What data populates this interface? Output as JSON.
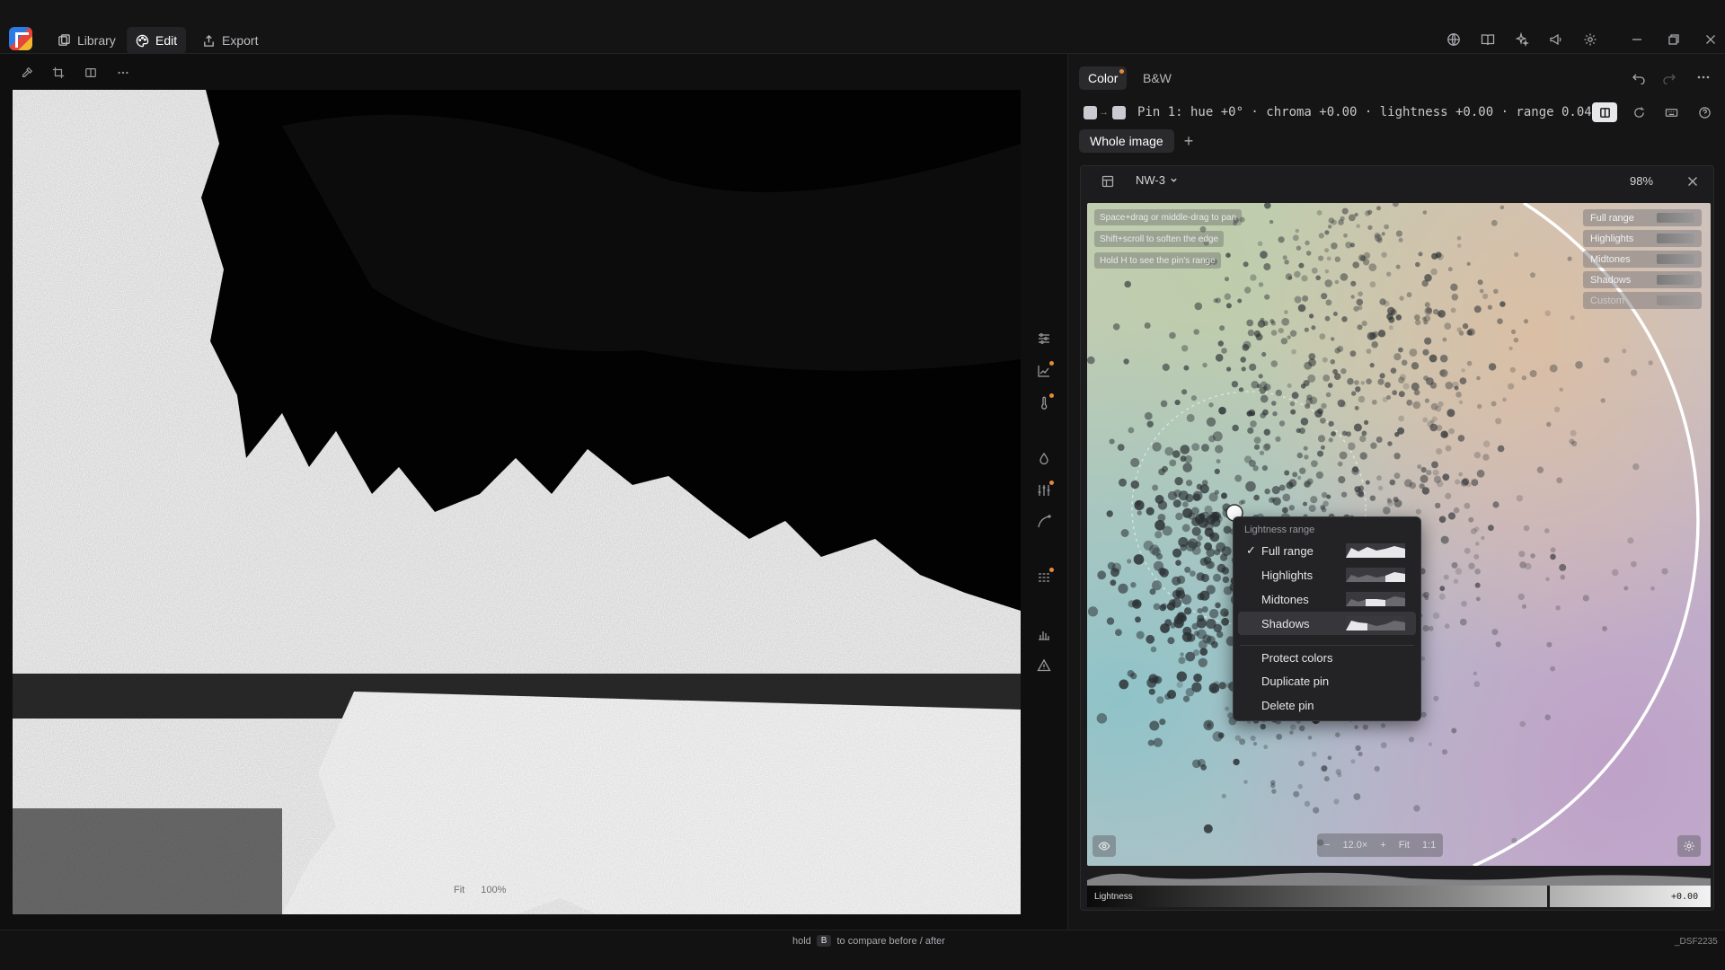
{
  "topbar": {
    "tabs": [
      {
        "label": "Library"
      },
      {
        "label": "Edit"
      },
      {
        "label": "Export"
      }
    ]
  },
  "viewer": {
    "zoom_fit_label": "Fit",
    "zoom_percent": "100%"
  },
  "panel": {
    "mode_tabs": [
      {
        "label": "Color"
      },
      {
        "label": "B&W"
      }
    ],
    "pin_summary": "Pin 1: hue +0° · chroma +0.00 · lightness +0.00 · range 0.04",
    "scope_tab": "Whole image",
    "add_scope": "+",
    "window_title": "NW-3",
    "window_zoom": "98%"
  },
  "wheel": {
    "hints": [
      "Space+drag or middle-drag to pan",
      "Shift+scroll to soften the edge",
      "Hold H to see the pin's range"
    ],
    "range_chips": [
      "Full range",
      "Highlights",
      "Midtones",
      "Shadows",
      "Custom"
    ],
    "bottom": {
      "minus": "−",
      "zoom": "12.0×",
      "plus": "+",
      "fit": "Fit",
      "one_to_one": "1:1"
    }
  },
  "lightness": {
    "label": "Lightness",
    "value": "+0.00"
  },
  "menu": {
    "heading": "Lightness range",
    "ranges": [
      {
        "label": "Full range",
        "checked": true
      },
      {
        "label": "Highlights",
        "checked": false
      },
      {
        "label": "Midtones",
        "checked": false
      },
      {
        "label": "Shadows",
        "checked": false
      }
    ],
    "actions": [
      "Protect colors",
      "Duplicate pin",
      "Delete pin"
    ]
  },
  "status": {
    "hint_prefix": "hold",
    "hint_key": "B",
    "hint_suffix": "to compare before / after",
    "filename": "_DSF2235"
  },
  "colors": {
    "accent_dot": "#e08a3a",
    "active_icon_bg": "#e8e8ea"
  }
}
